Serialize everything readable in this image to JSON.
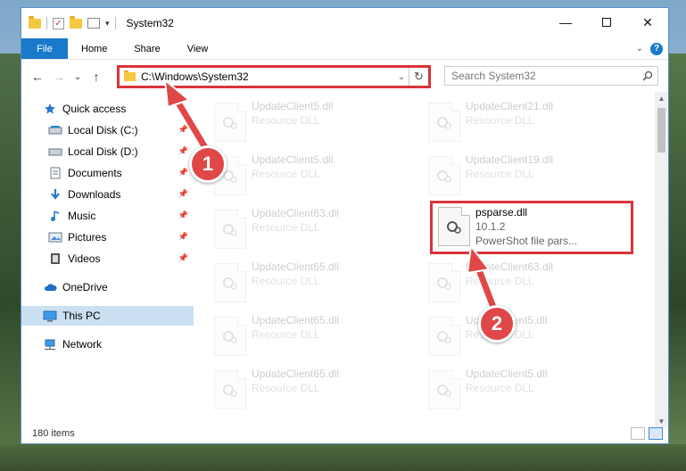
{
  "window": {
    "title": "System32",
    "controls": {
      "minimize": "—",
      "maximize": "",
      "close": "✕"
    }
  },
  "ribbon": {
    "tabs": [
      {
        "label": "File",
        "active": true
      },
      {
        "label": "Home"
      },
      {
        "label": "Share"
      },
      {
        "label": "View"
      }
    ],
    "help": "?"
  },
  "navbar": {
    "path": "C:\\Windows\\System32",
    "search_placeholder": "Search System32"
  },
  "sidebar": {
    "items": [
      {
        "label": "Quick access",
        "icon": "star-icon"
      },
      {
        "label": "Local Disk (C:)",
        "icon": "drive-icon",
        "pinned": true
      },
      {
        "label": "Local Disk (D:)",
        "icon": "drive-icon",
        "pinned": true
      },
      {
        "label": "Documents",
        "icon": "document-icon",
        "pinned": true
      },
      {
        "label": "Downloads",
        "icon": "download-icon",
        "pinned": true
      },
      {
        "label": "Music",
        "icon": "music-icon",
        "pinned": true
      },
      {
        "label": "Pictures",
        "icon": "picture-icon",
        "pinned": true
      },
      {
        "label": "Videos",
        "icon": "video-icon",
        "pinned": true
      },
      {
        "label": "OneDrive",
        "icon": "cloud-icon"
      },
      {
        "label": "This PC",
        "icon": "computer-icon",
        "selected": true
      },
      {
        "label": "Network",
        "icon": "network-icon"
      }
    ]
  },
  "files": {
    "left": [
      {
        "name": "UpdateClient5.dll",
        "type": "Resource DLL"
      },
      {
        "name": "UpdateClient5.dll",
        "type": "Resource DLL"
      },
      {
        "name": "UpdateClient63.dll",
        "type": "Resource DLL"
      },
      {
        "name": "UpdateClient65.dll",
        "type": "Resource DLL"
      },
      {
        "name": "UpdateClient65.dll",
        "type": "Resource DLL"
      },
      {
        "name": "UpdateClient65.dll",
        "type": "Resource DLL"
      }
    ],
    "right": [
      {
        "name": "UpdateClient21.dll",
        "type": "Resource DLL"
      },
      {
        "name": "UpdateClient19.dll",
        "type": "Resource DLL"
      },
      {
        "name": "psparse.dll",
        "version": "10.1.2",
        "type": "PowerShot file pars...",
        "highlighted": true
      },
      {
        "name": "UpdateClient63.dll",
        "type": "Resource DLL"
      },
      {
        "name": "UpdateClient5.dll",
        "type": "Resource DLL"
      },
      {
        "name": "UpdateClient5.dll",
        "type": "Resource DLL"
      }
    ]
  },
  "status": {
    "item_count": "180 items"
  },
  "annotations": {
    "step1": "1",
    "step2": "2",
    "color": "#e04848"
  }
}
